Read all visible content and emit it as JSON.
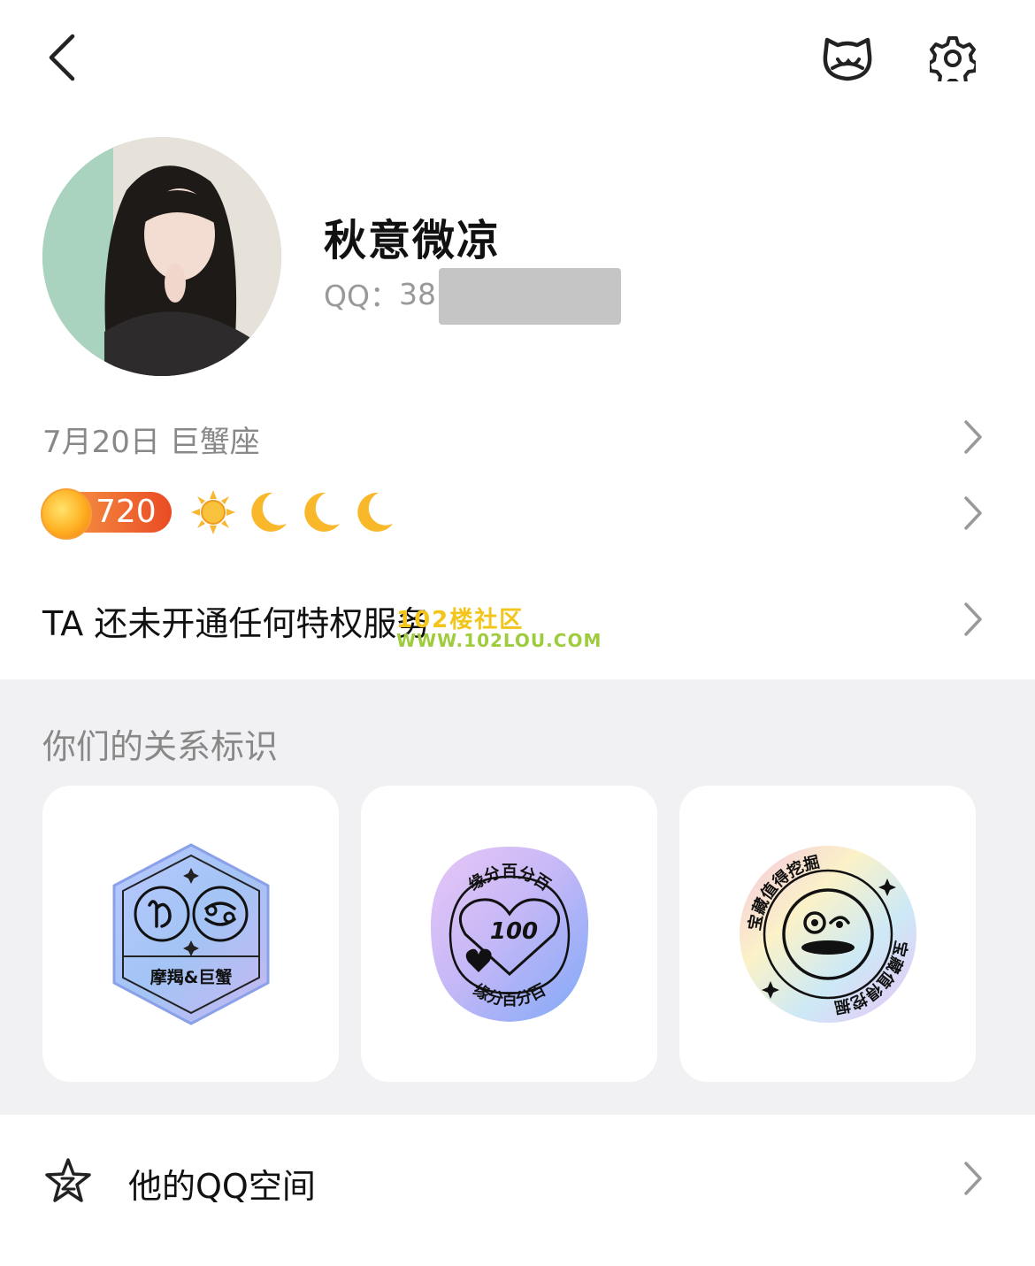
{
  "profile": {
    "nickname": "秋意微凉",
    "qq_label": "QQ：",
    "qq_prefix": "38"
  },
  "info": {
    "birthday": "7月20日 巨蟹座",
    "level": "720",
    "level_icons": [
      "sun-icon",
      "moon-icon",
      "moon-icon",
      "moon-icon"
    ],
    "privilege_text": "TA 还未开通任何特权服务"
  },
  "watermark": {
    "line1": "102楼社区",
    "line2": "WWW.102LOU.COM"
  },
  "relation": {
    "title": "你们的关系标识",
    "badges": [
      {
        "name": "zodiac-badge",
        "label": "摩羯&巨蟹"
      },
      {
        "name": "destiny-badge",
        "ring_text": "缘分百分百",
        "center_text": "100"
      },
      {
        "name": "treasure-badge",
        "ring_text": "宝藏值得挖掘"
      }
    ]
  },
  "qzone": {
    "label": "他的QQ空间"
  },
  "colors": {
    "accent_orange": "#ea4b24",
    "section_bg": "#f1f1f3",
    "muted_text": "#888888"
  }
}
